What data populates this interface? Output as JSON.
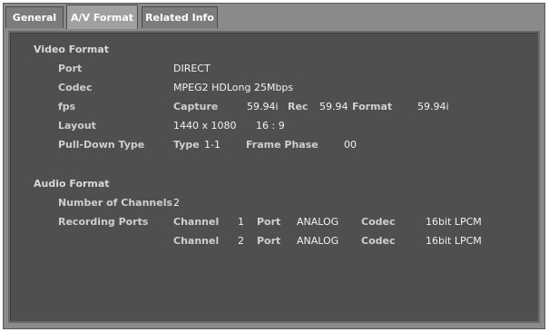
{
  "tabs": [
    "General",
    "A/V Format",
    "Related Info"
  ],
  "active_tab": 1,
  "video": {
    "heading": "Video Format",
    "port_label": "Port",
    "port_value": "DIRECT",
    "codec_label": "Codec",
    "codec_value": "MPEG2 HDLong 25Mbps",
    "fps_label": "fps",
    "capture_label": "Capture",
    "capture_value": "59.94i",
    "rec_label": "Rec",
    "rec_value": "59.94",
    "format_label": "Format",
    "format_value": "59.94i",
    "layout_label": "Layout",
    "layout_value": "1440 x 1080",
    "aspect_value": "16 : 9",
    "pulldown_label": "Pull-Down Type",
    "type_label": "Type",
    "type_value": "1-1",
    "frame_phase_label": "Frame Phase",
    "frame_phase_value": "00"
  },
  "audio": {
    "heading": "Audio Format",
    "channels_label": "Number of Channels",
    "channels_value": "2",
    "ports_label": "Recording Ports",
    "rows": [
      {
        "channel_label": "Channel",
        "channel": "1",
        "port_label": "Port",
        "port": "ANALOG",
        "codec_label": "Codec",
        "codec": "16bit LPCM"
      },
      {
        "channel_label": "Channel",
        "channel": "2",
        "port_label": "Port",
        "port": "ANALOG",
        "codec_label": "Codec",
        "codec": "16bit LPCM"
      }
    ]
  }
}
